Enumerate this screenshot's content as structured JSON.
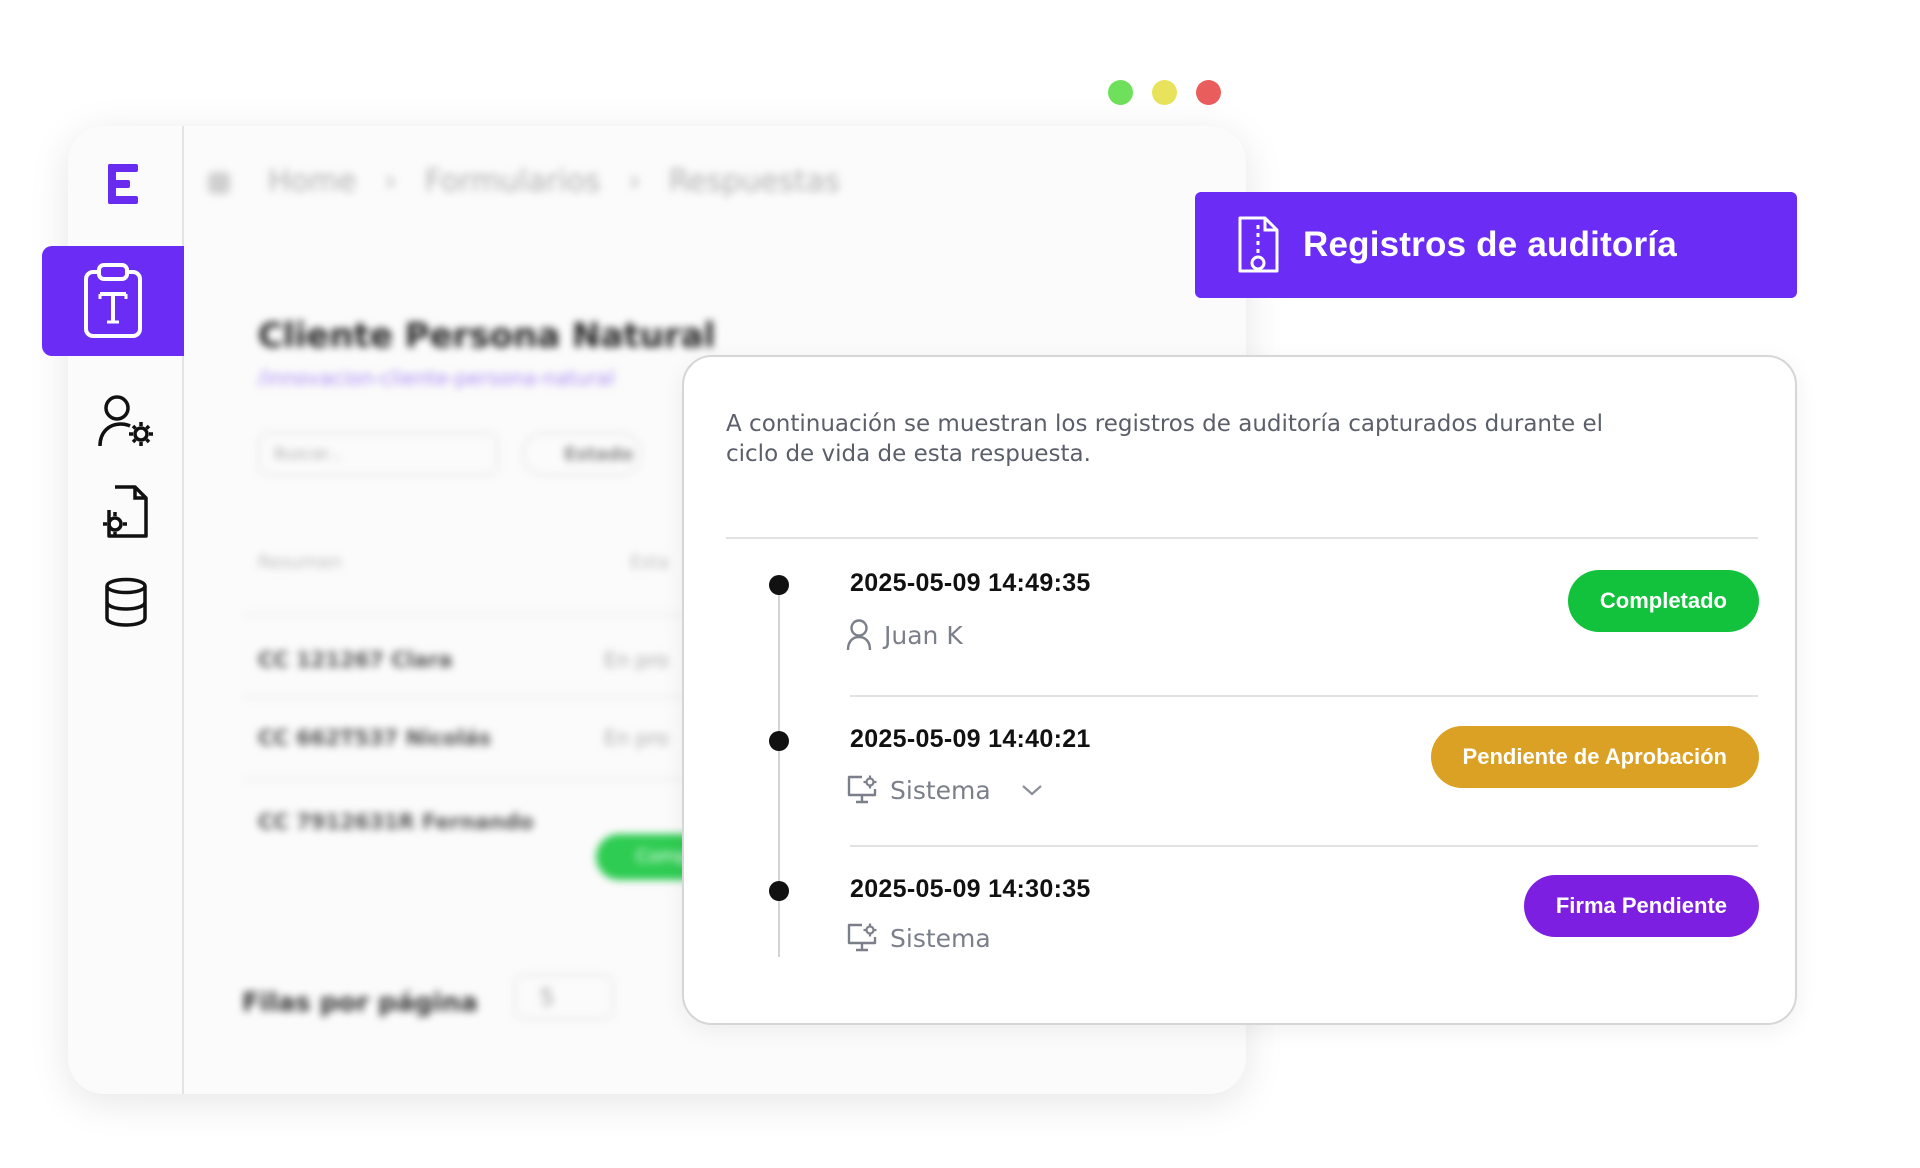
{
  "window_controls": {
    "colors": [
      "#6ee05b",
      "#e8e35a",
      "#ea5d5d"
    ]
  },
  "sidebar": {
    "active_color": "#6b2cf5",
    "icons": [
      "template-form-icon",
      "user-settings-icon",
      "file-settings-icon",
      "database-icon"
    ]
  },
  "background": {
    "breadcrumbs": [
      "Home",
      "Formularios",
      "Respuestas"
    ],
    "title": "Cliente Persona Natural",
    "subtitle": "/innovacion-cliente-persona-natural",
    "search_placeholder": "Buscar...",
    "filter_label": "Estado",
    "columns": [
      "Resumen",
      "Esta"
    ],
    "rows": [
      {
        "summary": "CC 121267 Clara",
        "status": "En pro"
      },
      {
        "summary": "CC 662T537 Nicolás",
        "status": "En pro"
      },
      {
        "summary": "CC 7912631R Fernando",
        "status": "Comp"
      }
    ],
    "rows_per_page_label": "Filas por página",
    "rows_per_page_value": "5"
  },
  "audit": {
    "header_title": "Registros de auditoría",
    "header_color": "#6b2cf5",
    "description": "A continuación se muestran los registros de auditoría capturados durante el ciclo de vida de esta respuesta.",
    "entries": [
      {
        "timestamp": "2025-05-09 14:49:35",
        "actor": "Juan K",
        "actor_icon": "user-icon",
        "status": "Completado",
        "status_color": "#12c23c"
      },
      {
        "timestamp": "2025-05-09 14:40:21",
        "actor": "Sistema",
        "actor_icon": "monitor-gear-icon",
        "status": "Pendiente de Aprobación",
        "status_color": "#dba124"
      },
      {
        "timestamp": "2025-05-09 14:30:35",
        "actor": "Sistema",
        "actor_icon": "monitor-gear-icon",
        "status": "Firma Pendiente",
        "status_color": "#7c1fe0"
      }
    ]
  }
}
